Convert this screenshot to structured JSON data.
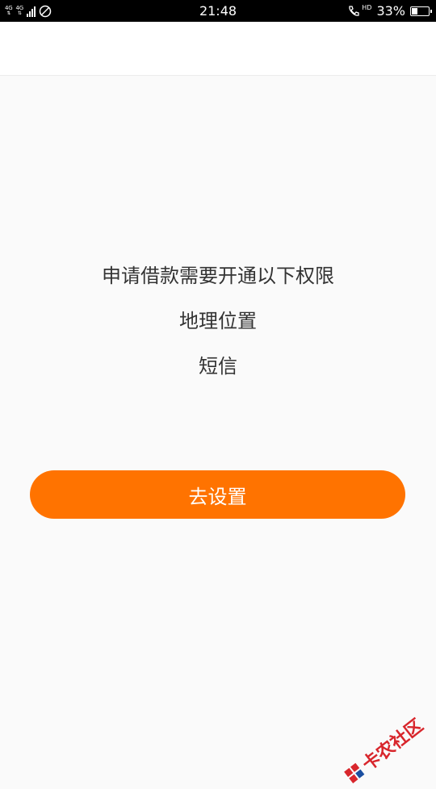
{
  "status_bar": {
    "network_type": "4G",
    "network_type_2": "4G",
    "time": "21:48",
    "hd_label": "HD",
    "battery_percent": "33%",
    "battery_level": 0.33
  },
  "permissions": {
    "heading": "申请借款需要开通以下权限",
    "items": [
      "地理位置",
      "短信"
    ]
  },
  "settings_button": {
    "label": "去设置",
    "color": "#ff7300"
  },
  "watermark": {
    "text": "卡农社区",
    "color": "#d8262c"
  }
}
